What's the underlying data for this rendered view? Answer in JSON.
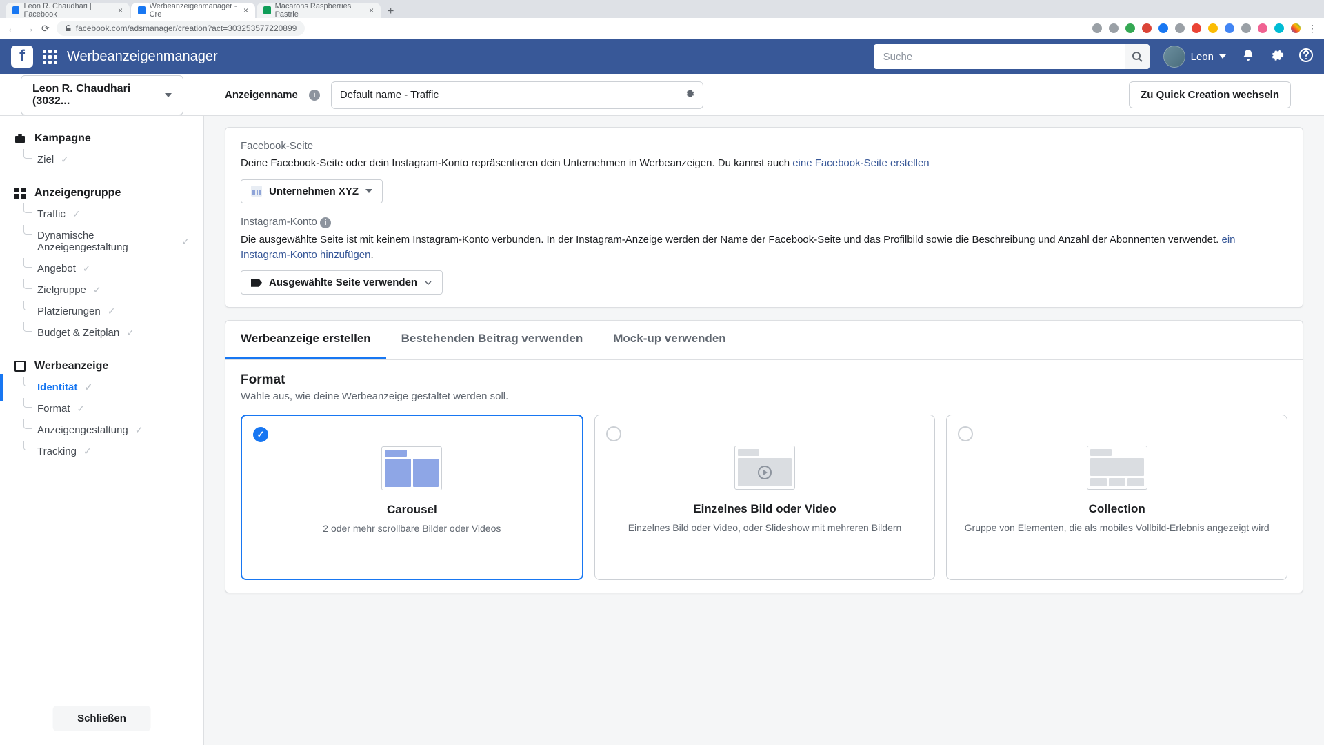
{
  "browser": {
    "tabs": [
      {
        "title": "Leon R. Chaudhari | Facebook",
        "favicon": "#1877f2"
      },
      {
        "title": "Werbeanzeigenmanager - Cre",
        "favicon": "#1877f2",
        "active": true
      },
      {
        "title": "Macarons Raspberries Pastrie",
        "favicon": "#0f9d58"
      }
    ],
    "url": "facebook.com/adsmanager/creation?act=303253577220899"
  },
  "header": {
    "app_title": "Werbeanzeigenmanager",
    "search_placeholder": "Suche",
    "user_name": "Leon"
  },
  "subheader": {
    "account_dd": "Leon R. Chaudhari (3032...",
    "name_label": "Anzeigenname",
    "name_value": "Default name - Traffic",
    "quick_btn": "Zu Quick Creation wechseln"
  },
  "sidebar": {
    "campaign": {
      "head": "Kampagne",
      "items": [
        "Ziel"
      ]
    },
    "adset": {
      "head": "Anzeigengruppe",
      "items": [
        "Traffic",
        "Dynamische Anzeigengestaltung",
        "Angebot",
        "Zielgruppe",
        "Platzierungen",
        "Budget & Zeitplan"
      ]
    },
    "ad": {
      "head": "Werbeanzeige",
      "items": [
        "Identität",
        "Format",
        "Anzeigengestaltung",
        "Tracking"
      ],
      "active_index": 0
    },
    "close": "Schließen"
  },
  "identity": {
    "fb_page_label": "Facebook-Seite",
    "fb_page_body": "Deine Facebook-Seite oder dein Instagram-Konto repräsentieren dein Unternehmen in Werbeanzeigen. Du kannst auch ",
    "fb_page_link": "eine Facebook-Seite erstellen",
    "fb_page_selected": "Unternehmen XYZ",
    "ig_label": "Instagram-Konto",
    "ig_body1": "Die ausgewählte Seite ist mit keinem Instagram-Konto verbunden. In der Instagram-Anzeige werden der Name der Facebook-Seite und das Profilbild sowie die Beschreibung und Anzahl der Abonnenten verwendet. ",
    "ig_link": "ein Instagram-Konto hinzufügen",
    "ig_body2": ".",
    "ig_selected": "Ausgewählte Seite verwenden"
  },
  "creative_tabs": {
    "items": [
      "Werbeanzeige erstellen",
      "Bestehenden Beitrag verwenden",
      "Mock-up verwenden"
    ],
    "active": 0
  },
  "format": {
    "title": "Format",
    "subtitle": "Wähle aus, wie deine Werbeanzeige gestaltet werden soll.",
    "options": [
      {
        "title": "Carousel",
        "desc": "2 oder mehr scrollbare Bilder oder Videos",
        "selected": true
      },
      {
        "title": "Einzelnes Bild oder Video",
        "desc": "Einzelnes Bild oder Video, oder Slideshow mit mehreren Bildern",
        "selected": false
      },
      {
        "title": "Collection",
        "desc": "Gruppe von Elementen, die als mobiles Vollbild-Erlebnis angezeigt wird",
        "selected": false
      }
    ]
  }
}
